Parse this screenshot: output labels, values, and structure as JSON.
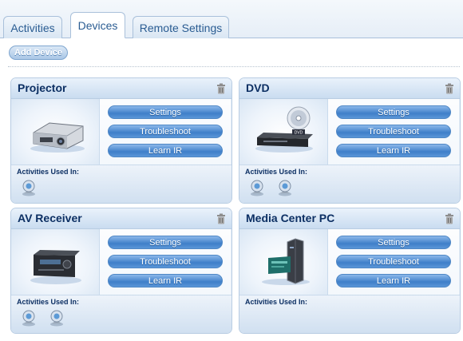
{
  "tabs": [
    {
      "label": "Activities"
    },
    {
      "label": "Devices"
    },
    {
      "label": "Remote Settings"
    }
  ],
  "toolbar": {
    "add_device_label": "Add Device"
  },
  "device_buttons": {
    "settings": "Settings",
    "troubleshoot": "Troubleshoot",
    "learn_ir": "Learn IR"
  },
  "activities_used_in_label": "Activities Used In:",
  "devices": [
    {
      "name": "Projector",
      "image": "projector-icon",
      "activity_count": 1
    },
    {
      "name": "DVD",
      "image": "dvd-player-icon",
      "activity_count": 2
    },
    {
      "name": "AV Receiver",
      "image": "av-receiver-icon",
      "activity_count": 2
    },
    {
      "name": "Media Center PC",
      "image": "media-center-pc-icon",
      "activity_count": 0
    }
  ],
  "colors": {
    "accent": "#3f7fc9",
    "title": "#0c2f63",
    "tab_text": "#2a5c92"
  }
}
